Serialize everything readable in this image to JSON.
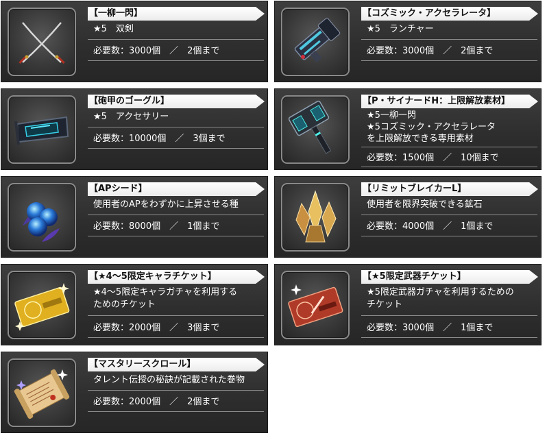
{
  "items": [
    {
      "title": "【一柳一閃】",
      "desc_lines": [
        "★5　双剣"
      ],
      "requirement": "必要数：3000個　／　2個まで",
      "icon": "crossed-swords-icon"
    },
    {
      "title": "【コズミック・アクセラレータ】",
      "desc_lines": [
        "★5　ランチャー"
      ],
      "requirement": "必要数：3000個　／　2個まで",
      "icon": "launcher-icon"
    },
    {
      "title": "【砲甲のゴーグル】",
      "desc_lines": [
        "★5　アクセサリー"
      ],
      "requirement": "必要数：10000個　／　3個まで",
      "icon": "goggles-icon"
    },
    {
      "title": "【P・サイナードH：上限解放素材】",
      "desc_lines": [
        "★5一柳一閃",
        "★5コズミック・アクセラレータ",
        "を上限解放できる専用素材"
      ],
      "requirement": "必要数：1500個　／　10個まで",
      "icon": "hammer-icon"
    },
    {
      "title": "【APシード】",
      "desc_lines": [
        "使用者のAPをわずかに上昇させる種"
      ],
      "requirement": "必要数：8000個　／　1個まで",
      "icon": "blue-seeds-icon"
    },
    {
      "title": "【リミットブレイカーL】",
      "desc_lines": [
        "使用者を限界突破できる鉱石"
      ],
      "requirement": "必要数：4000個　／　1個まで",
      "icon": "crystal-ore-icon"
    },
    {
      "title": "【★4～5限定キャラチケット】",
      "desc_lines": [
        "★4～5限定キャラガチャを利用する",
        "ためのチケット"
      ],
      "requirement": "必要数：2000個　／　3個まで",
      "icon": "gold-ticket-icon"
    },
    {
      "title": "【★5限定武器チケット】",
      "desc_lines": [
        "★5限定武器ガチャを利用するための",
        "チケット"
      ],
      "requirement": "必要数：3000個　／　1個まで",
      "icon": "red-ticket-icon"
    },
    {
      "title": "【マスタリースクロール】",
      "desc_lines": [
        "タレント伝授の秘訣が記載された巻物"
      ],
      "requirement": "必要数：2000個　／　2個まで",
      "icon": "scroll-icon"
    }
  ]
}
